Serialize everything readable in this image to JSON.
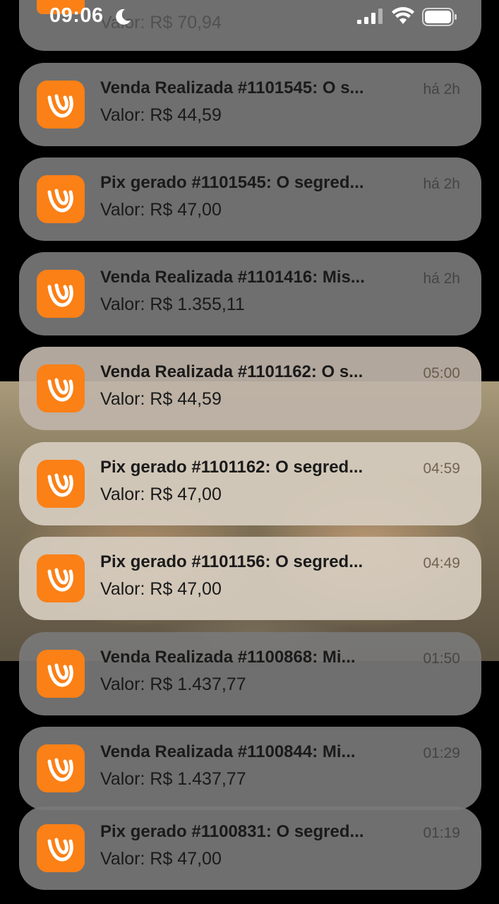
{
  "status_bar": {
    "time": "09:06",
    "moon_icon": "moon-icon",
    "signal_icon": "cellular-signal-icon",
    "wifi_icon": "wifi-icon",
    "battery_icon": "battery-icon"
  },
  "top_partial": {
    "body": "Valor: R$ 70,94"
  },
  "notifications": [
    {
      "title": "Venda Realizada #1101545: O s...",
      "body": "Valor: R$ 44,59",
      "time": "há 2h"
    },
    {
      "title": "Pix gerado #1101545: O segred...",
      "body": "Valor: R$ 47,00",
      "time": "há 2h"
    },
    {
      "title": "Venda Realizada #1101416: Mis...",
      "body": "Valor: R$ 1.355,11",
      "time": "há 2h"
    },
    {
      "title": "Venda Realizada #1101162: O s...",
      "body": "Valor: R$ 44,59",
      "time": "05:00"
    },
    {
      "title": "Pix gerado #1101162: O segred...",
      "body": "Valor: R$ 47,00",
      "time": "04:59"
    },
    {
      "title": "Pix gerado #1101156: O segred...",
      "body": "Valor: R$ 47,00",
      "time": "04:49"
    },
    {
      "title": "Venda Realizada #1100868: Mi...",
      "body": "Valor: R$ 1.437,77",
      "time": "01:50"
    },
    {
      "title": "Venda Realizada #1100844: Mi...",
      "body": "Valor: R$ 1.437,77",
      "time": "01:29"
    },
    {
      "title": "Pix gerado #1100831: O segred...",
      "body": "Valor: R$ 47,00",
      "time": "01:19"
    }
  ],
  "colors": {
    "app_icon": "#fb8016",
    "card_gray": "#787878",
    "background": "#000000"
  }
}
